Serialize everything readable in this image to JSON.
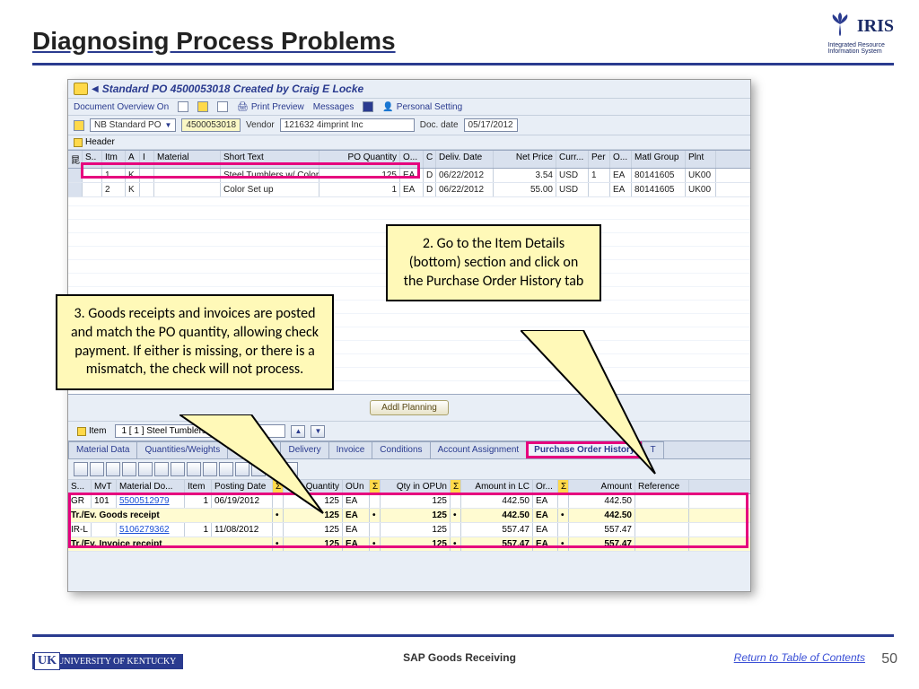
{
  "slide": {
    "title": "Diagnosing Process Problems",
    "page_number": "50",
    "footer_center": "SAP Goods Receiving",
    "footer_link": "Return to Table of Contents",
    "uk_text": "UNIVERSITY OF KENTUCKY",
    "iris_brand": "IRIS",
    "iris_sub1": "Integrated Resource",
    "iris_sub2": "Information System"
  },
  "sap": {
    "window_title": "Standard PO 4500053018 Created by Craig E Locke",
    "toolbar": {
      "doc_overview": "Document Overview On",
      "print_preview": "Print Preview",
      "messages": "Messages",
      "personal_setting": "Personal Setting"
    },
    "header": {
      "po_type": "NB Standard PO",
      "po_number": "4500053018",
      "vendor_lbl": "Vendor",
      "vendor_val": "121632 4imprint Inc",
      "docdate_lbl": "Doc. date",
      "docdate_val": "05/17/2012",
      "header_btn": "Header"
    },
    "grid_cols": [
      "S..",
      "Itm",
      "A",
      "I",
      "Material",
      "Short Text",
      "PO Quantity",
      "O...",
      "C",
      "Deliv. Date",
      "Net Price",
      "Curr...",
      "Per",
      "O...",
      "Matl Group",
      "Plnt"
    ],
    "rows": [
      {
        "itm": "1",
        "a": "K",
        "short": "Steel Tumblers w/ Color ..",
        "qty": "125",
        "ou": "EA",
        "c": "D",
        "deliv": "06/22/2012",
        "price": "3.54",
        "curr": "USD",
        "per": "1",
        "o": "EA",
        "matl": "80141605",
        "plnt": "UK00"
      },
      {
        "itm": "2",
        "a": "K",
        "short": "Color Set up",
        "qty": "1",
        "ou": "EA",
        "c": "D",
        "deliv": "06/22/2012",
        "price": "55.00",
        "curr": "USD",
        "per": "",
        "o": "EA",
        "matl": "80141605",
        "plnt": "UK00"
      }
    ],
    "addl_planning": "Addl Planning",
    "item_lbl": "Item",
    "item_sel": "1 [ 1 ] Steel Tumblers w/ C",
    "tabs": [
      "Material Data",
      "Quantities/Weights",
      "Del         edule",
      "Delivery",
      "Invoice",
      "Conditions",
      "Account Assignment",
      "Purchase Order History",
      "T"
    ],
    "hist_cols": [
      "S...",
      "MvT",
      "Material Do...",
      "Item",
      "Posting Date",
      "Σ",
      "Quantity",
      "OUn",
      "Σ",
      "Qty in OPUn",
      "Σ",
      "Amount in LC",
      "Or...",
      "Σ",
      "Amount",
      "Reference"
    ],
    "hist_rows": [
      {
        "type": "w",
        "s": "GR",
        "mvt": "101",
        "doc": "5500512979",
        "item": "1",
        "date": "06/19/2012",
        "qty": "125",
        "oun": "EA",
        "qop": "125",
        "amt": "442.50",
        "or": "EA",
        "amt2": "442.50"
      },
      {
        "type": "y",
        "s": "Tr./Ev. Goods receipt",
        "qty": "125",
        "oun": "EA",
        "qop": "125",
        "amt": "442.50",
        "or": "EA",
        "amt2": "442.50"
      },
      {
        "type": "w",
        "s": "IR-L",
        "mvt": "",
        "doc": "5106279362",
        "item": "1",
        "date": "11/08/2012",
        "qty": "125",
        "oun": "EA",
        "qop": "125",
        "amt": "557.47",
        "or": "EA",
        "amt2": "557.47"
      },
      {
        "type": "y",
        "s": "Tr./Ev. Invoice receipt",
        "qty": "125",
        "oun": "EA",
        "qop": "125",
        "amt": "557.47",
        "or": "EA",
        "amt2": "557.47"
      }
    ]
  },
  "callouts": {
    "c2": "2. Go to the Item Details (bottom) section and click on the Purchase Order History tab",
    "c3": "3. Goods receipts and invoices are posted and match the PO quantity, allowing check payment. If either is missing, or there is a mismatch, the check will not process."
  }
}
